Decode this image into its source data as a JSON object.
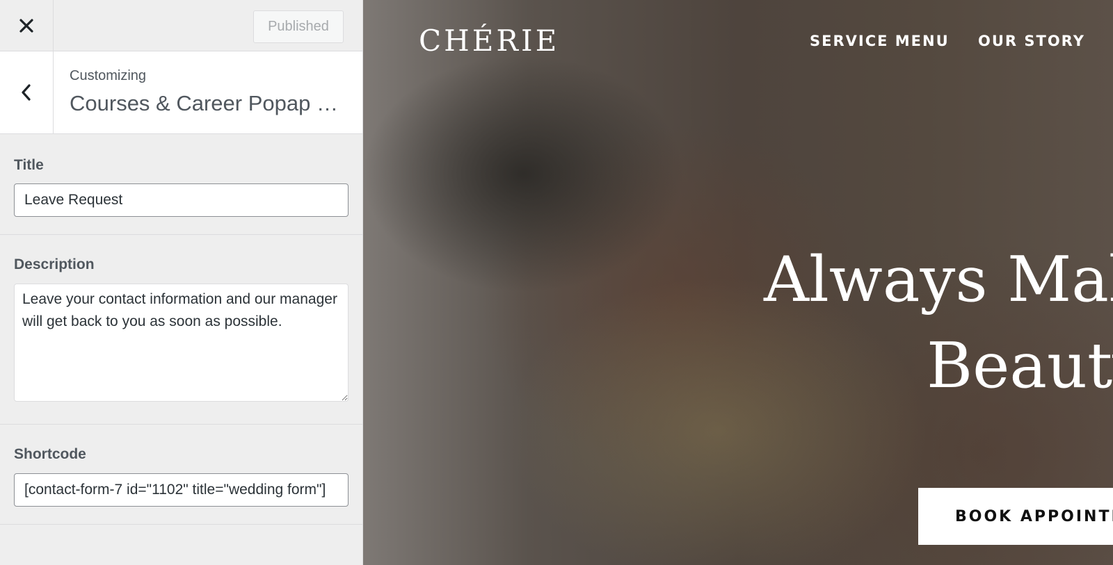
{
  "topbar": {
    "close_icon": "close-icon",
    "publish_label": "Published"
  },
  "header": {
    "back_icon": "chevron-left-icon",
    "eyebrow": "Customizing",
    "title": "Courses & Career Popap Settings"
  },
  "fields": {
    "title": {
      "label": "Title",
      "value": "Leave Request"
    },
    "description": {
      "label": "Description",
      "value": "Leave your contact information and our manager will get back to you as soon as possible."
    },
    "shortcode": {
      "label": "Shortcode",
      "value": "[contact-form-7 id=\"1102\" title=\"wedding form\"]"
    }
  },
  "preview": {
    "brand": "CHÉRIE",
    "nav": [
      "SERVICE MENU",
      "OUR STORY"
    ],
    "hero": [
      "Always Make",
      "Beauty"
    ],
    "cta": "BOOK APPOINTMENT"
  },
  "colors": {
    "sidebar_bg": "#eeeeee",
    "header_bg": "#ffffff",
    "label_text": "#50575e",
    "published_text": "#a7aaad"
  }
}
